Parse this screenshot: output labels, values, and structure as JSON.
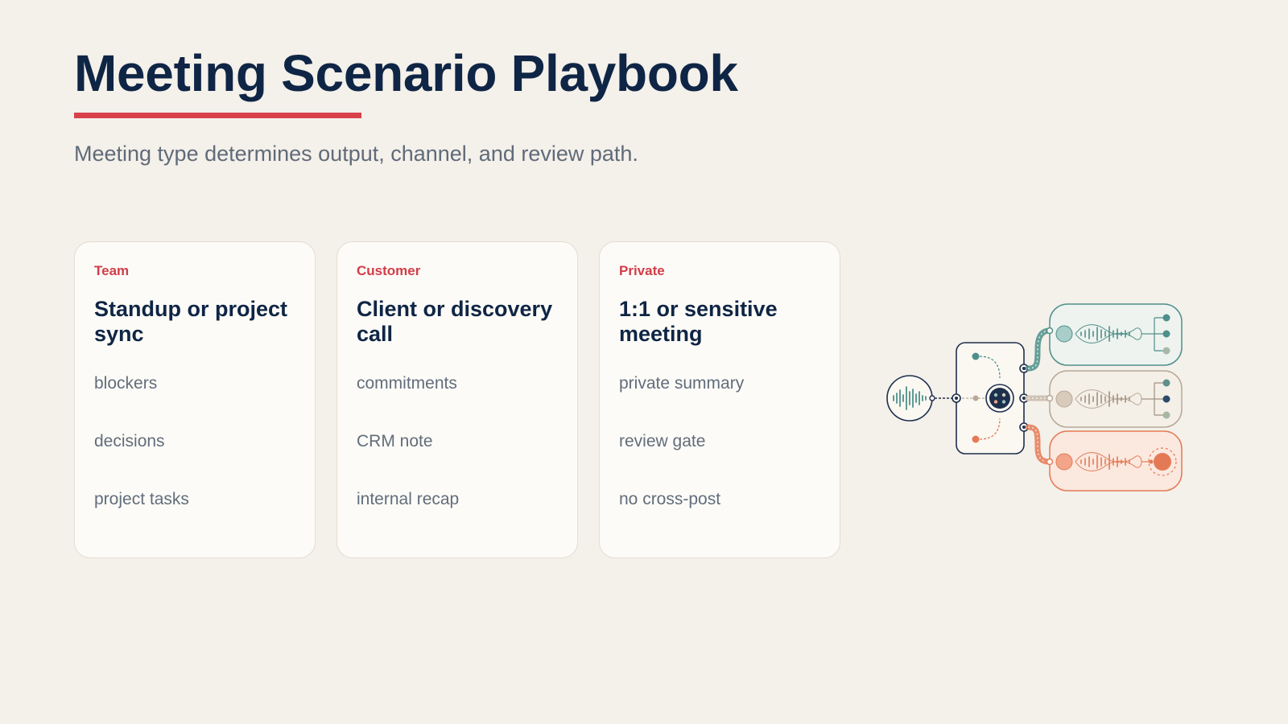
{
  "header": {
    "title": "Meeting Scenario Playbook",
    "subtitle": "Meeting type determines output, channel, and review path."
  },
  "cards": [
    {
      "tag": "Team",
      "title": "Standup or project sync",
      "items": [
        "blockers",
        "decisions",
        "project tasks"
      ]
    },
    {
      "tag": "Customer",
      "title": "Client or discovery call",
      "items": [
        "commitments",
        "CRM note",
        "internal recap"
      ]
    },
    {
      "tag": "Private",
      "title": "1:1 or sensitive meeting",
      "items": [
        "private summary",
        "review gate",
        "no cross-post"
      ]
    }
  ],
  "colors": {
    "background": "#f4f0ea",
    "title": "#0f2545",
    "accent": "#d8404a",
    "team": "#4e8f8a",
    "customer": "#b7a898",
    "private": "#e47a55"
  },
  "illustration": {
    "icons": [
      "audio-waveform-icon",
      "router-hub-icon",
      "team-path-icon",
      "customer-path-icon",
      "private-path-icon"
    ]
  }
}
